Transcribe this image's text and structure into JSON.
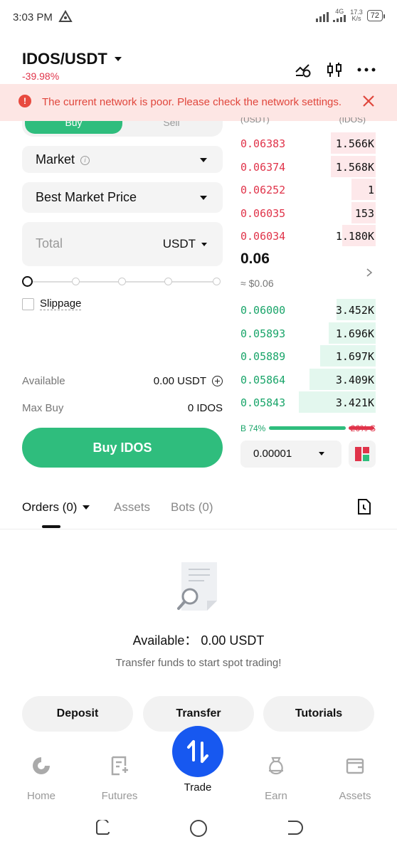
{
  "status": {
    "time": "3:03 PM",
    "network": "4G",
    "speed_value": "17.3",
    "speed_unit": "K/s",
    "battery": "72"
  },
  "header": {
    "pair": "IDOS/USDT",
    "change": "-39.98%"
  },
  "alert": {
    "message": "The current network is poor. Please check the network settings."
  },
  "form": {
    "buy_tab": "Buy",
    "sell_tab": "Sell",
    "order_type": "Market",
    "price_mode": "Best Market Price",
    "total_placeholder": "Total",
    "total_currency": "USDT",
    "slippage_label": "Slippage",
    "available_label": "Available",
    "available_value": "0.00 USDT",
    "maxbuy_label": "Max Buy",
    "maxbuy_value": "0 IDOS",
    "buy_button": "Buy IDOS"
  },
  "orderbook": {
    "header_price": "(USDT)",
    "header_qty": "(IDOS)",
    "asks": [
      {
        "price": "0.06383",
        "qty": "1.566K",
        "depth": 0.33
      },
      {
        "price": "0.06374",
        "qty": "1.568K",
        "depth": 0.33
      },
      {
        "price": "0.06252",
        "qty": "1",
        "depth": 0.18
      },
      {
        "price": "0.06035",
        "qty": "153",
        "depth": 0.18
      },
      {
        "price": "0.06034",
        "qty": "1.180K",
        "depth": 0.25
      }
    ],
    "last_price": "0.06",
    "last_price_usd": "≈ $0.06",
    "bids": [
      {
        "price": "0.06000",
        "qty": "3.452K",
        "depth": 0.29
      },
      {
        "price": "0.05893",
        "qty": "1.696K",
        "depth": 0.35
      },
      {
        "price": "0.05889",
        "qty": "1.697K",
        "depth": 0.41
      },
      {
        "price": "0.05864",
        "qty": "3.409K",
        "depth": 0.49
      },
      {
        "price": "0.05843",
        "qty": "3.421K",
        "depth": 0.57
      }
    ],
    "buy_ratio": "B 74%",
    "sell_ratio": "26% S",
    "buy_fraction": 0.74,
    "precision": "0.00001"
  },
  "orders": {
    "tabs": [
      "Orders (0)",
      "Assets",
      "Bots (0)"
    ],
    "available_text": "Available： 0.00 USDT",
    "empty_hint": "Transfer funds to start spot trading!",
    "actions": [
      "Deposit",
      "Transfer",
      "Tutorials"
    ]
  },
  "nav": {
    "items": [
      "Home",
      "Futures",
      "Trade",
      "Earn",
      "Assets"
    ]
  },
  "colors": {
    "buy_green": "#2fbd7d",
    "sell_red": "#e0344a",
    "trade_blue": "#1758f0"
  }
}
